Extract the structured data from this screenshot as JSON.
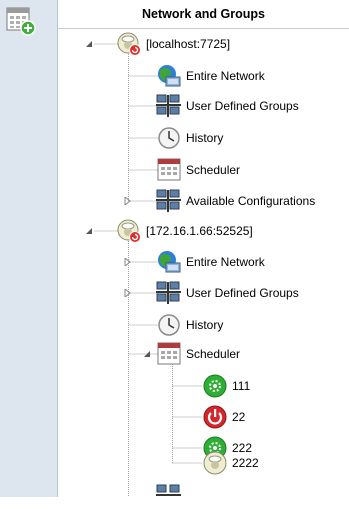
{
  "header": {
    "title": "Network and Groups"
  },
  "toolbar": {
    "add_icon": "add-scheduler-icon"
  },
  "tree": {
    "servers": [
      {
        "label": "[localhost:7725]",
        "expanded": true,
        "children": [
          {
            "label": "Entire Network",
            "icon": "globe-network-icon"
          },
          {
            "label": "User Defined Groups",
            "icon": "network-group-icon"
          },
          {
            "label": "History",
            "icon": "clock-icon"
          },
          {
            "label": "Scheduler",
            "icon": "calendar-icon"
          },
          {
            "label": "Available Configurations",
            "icon": "network-group-icon"
          }
        ]
      },
      {
        "label": "[172.16.1.66:52525]",
        "expanded": true,
        "children": [
          {
            "label": "Entire Network",
            "icon": "globe-network-icon"
          },
          {
            "label": "User Defined Groups",
            "icon": "network-group-icon"
          },
          {
            "label": "History",
            "icon": "clock-icon"
          },
          {
            "label": "Scheduler",
            "icon": "calendar-icon",
            "expanded": true,
            "tasks": [
              {
                "label": "111",
                "icon": "task-running-icon"
              },
              {
                "label": "22",
                "icon": "task-stopped-icon"
              },
              {
                "label": "222",
                "icon": "task-running-icon"
              },
              {
                "label": "2222",
                "icon": "task-idle-icon"
              }
            ]
          }
        ]
      }
    ]
  }
}
